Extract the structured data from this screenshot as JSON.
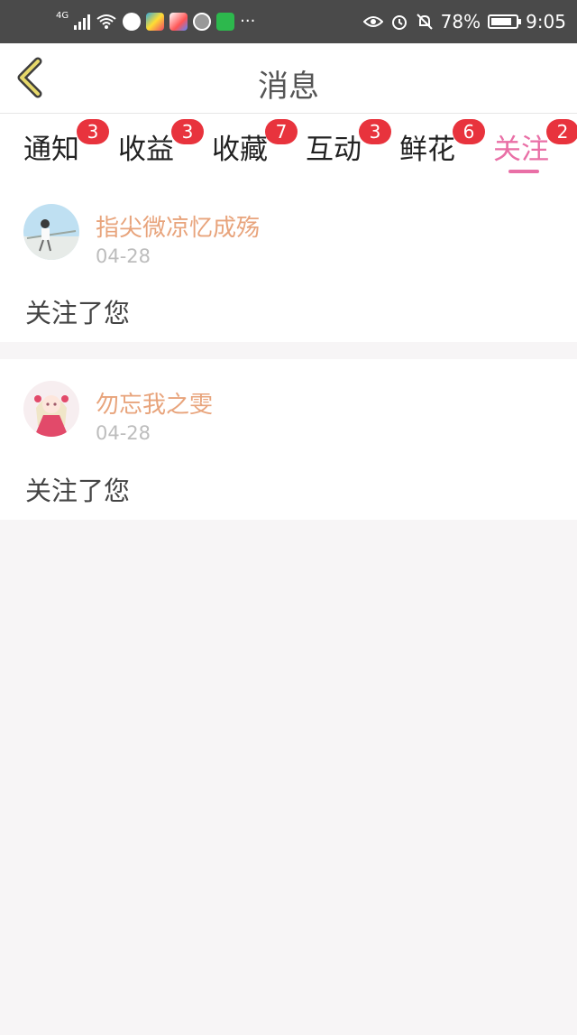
{
  "status_bar": {
    "network": "4G",
    "battery": "78%",
    "time": "9:05",
    "icons": [
      "signal-icon",
      "wifi-icon",
      "app-notification-icons",
      "more-icon",
      "eye-icon",
      "alarm-icon",
      "mute-bell-icon",
      "battery-icon"
    ]
  },
  "header": {
    "title": "消息",
    "back_icon": "chevron-left-icon"
  },
  "tabs": [
    {
      "label": "通知",
      "badge": "3"
    },
    {
      "label": "收益",
      "badge": "3"
    },
    {
      "label": "收藏",
      "badge": "7"
    },
    {
      "label": "互动",
      "badge": "3"
    },
    {
      "label": "鲜花",
      "badge": "6"
    },
    {
      "label": "关注",
      "badge": "2",
      "active": true
    }
  ],
  "notifications": [
    {
      "username": "指尖微凉忆成殇",
      "date": "04-28",
      "message": "关注了您"
    },
    {
      "username": "勿忘我之雯",
      "date": "04-28",
      "message": "关注了您"
    }
  ],
  "colors": {
    "accent": "#e96fa6",
    "badge": "#e8333d",
    "username": "#e8a47c",
    "status_bar": "#4a4a4a"
  }
}
